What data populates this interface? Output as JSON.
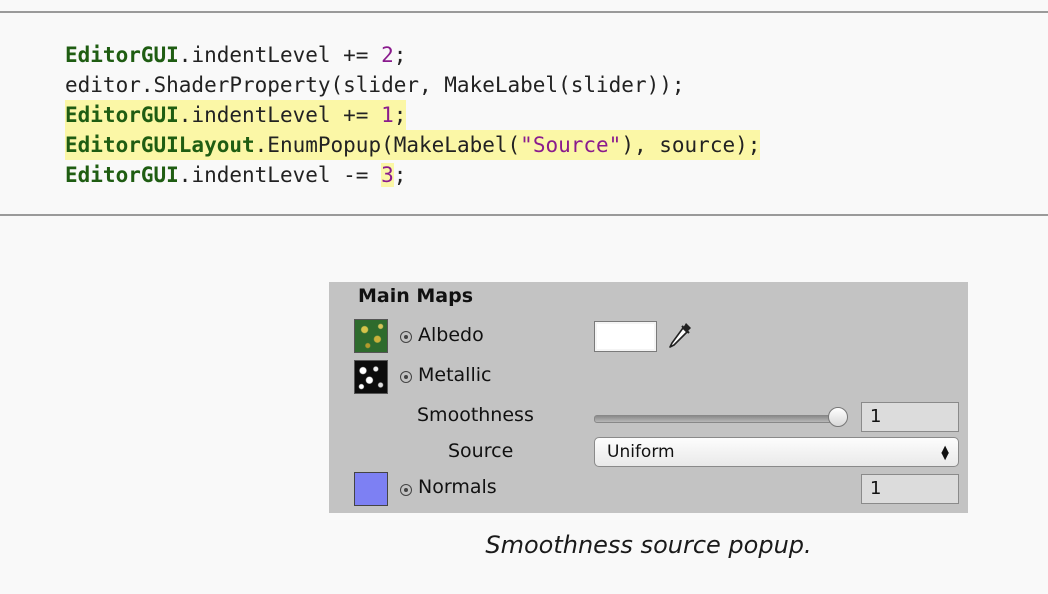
{
  "code": {
    "line1": {
      "kw": "EditorGUI",
      "mid": ".indentLevel += ",
      "num": "2",
      "end": ";"
    },
    "line2": {
      "text": "editor.ShaderProperty(slider, MakeLabel(slider));"
    },
    "line3": {
      "kw": "EditorGUI",
      "mid": ".indentLevel += ",
      "num": "1",
      "end": ";"
    },
    "line4": {
      "kw": "EditorGUILayout",
      "mid": ".EnumPopup(MakeLabel(",
      "str": "\"Source\"",
      "end": "), source);"
    },
    "line5": {
      "kw": "EditorGUI",
      "mid": ".indentLevel -= ",
      "num": "3",
      "end": ";"
    }
  },
  "panel": {
    "title": "Main Maps",
    "albedo": {
      "label": "Albedo",
      "color": "#ffffff",
      "thumb_icon": "albedo-texture-icon"
    },
    "metallic": {
      "label": "Metallic",
      "thumb_icon": "metallic-texture-icon"
    },
    "smoothness": {
      "label": "Smoothness",
      "value": "1",
      "slider_fraction": 1.0
    },
    "source": {
      "label": "Source",
      "selected": "Uniform"
    },
    "normals": {
      "label": "Normals",
      "value": "1",
      "thumb_color": "#7d80f3"
    }
  },
  "caption": "Smoothness source popup."
}
